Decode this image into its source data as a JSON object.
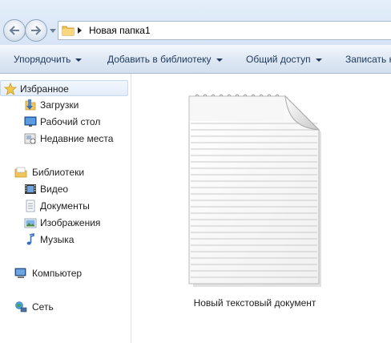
{
  "address": {
    "path": "Новая папка1"
  },
  "toolbar": {
    "organize": "Упорядочить",
    "add_to_library": "Добавить в библиотеку",
    "share": "Общий доступ",
    "burn": "Записать н"
  },
  "sidebar": {
    "favorites": "Избранное",
    "downloads": "Загрузки",
    "desktop": "Рабочий стол",
    "recent": "Недавние места",
    "libraries": "Библиотеки",
    "video": "Видео",
    "documents": "Документы",
    "pictures": "Изображения",
    "music": "Музыка",
    "computer": "Компьютер",
    "network": "Сеть"
  },
  "content": {
    "file_name": "Новый текстовый документ",
    "file_icon": "text-document-icon"
  }
}
